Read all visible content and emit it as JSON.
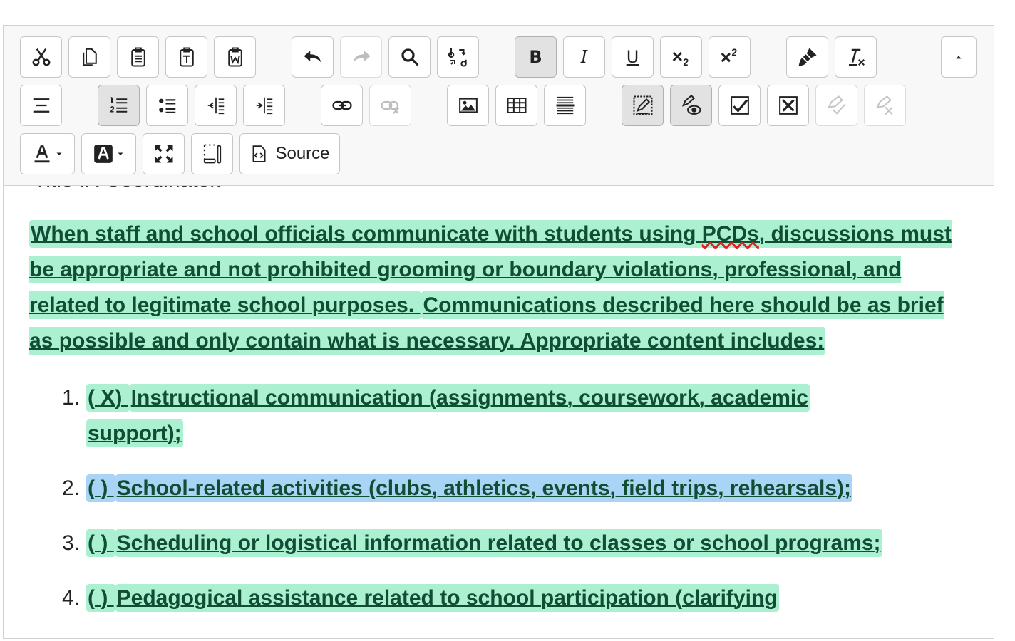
{
  "toolbar": {
    "rows": [
      [
        {
          "name": "cut-button",
          "icon": "scissors-icon"
        },
        {
          "name": "copy-button",
          "icon": "copy-icon"
        },
        {
          "name": "paste-button",
          "icon": "clipboard-icon"
        },
        {
          "name": "paste-text-button",
          "icon": "clipboard-text-icon"
        },
        {
          "name": "paste-word-button",
          "icon": "clipboard-word-icon"
        },
        {
          "name": "undo-button",
          "icon": "undo-icon"
        },
        {
          "name": "redo-button",
          "icon": "redo-icon"
        },
        {
          "name": "find-button",
          "icon": "search-icon"
        },
        {
          "name": "replace-button",
          "icon": "replace-icon"
        },
        {
          "name": "bold-button",
          "icon": "bold-icon",
          "state": "active"
        },
        {
          "name": "italic-button",
          "icon": "italic-icon"
        },
        {
          "name": "underline-button",
          "icon": "underline-icon"
        },
        {
          "name": "subscript-button",
          "icon": "subscript-icon"
        },
        {
          "name": "superscript-button",
          "icon": "superscript-icon"
        },
        {
          "name": "copy-format-button",
          "icon": "paintbrush-icon"
        },
        {
          "name": "remove-format-button",
          "icon": "remove-format-icon"
        },
        {
          "name": "collapse-toolbar-button",
          "icon": "triangle-up-icon"
        }
      ],
      [
        {
          "name": "paragraph-format-button",
          "icon": "paragraph-icon"
        },
        {
          "name": "numbered-list-button",
          "icon": "numbered-list-icon",
          "state": "active"
        },
        {
          "name": "bulleted-list-button",
          "icon": "bulleted-list-icon"
        },
        {
          "name": "decrease-indent-button",
          "icon": "outdent-icon"
        },
        {
          "name": "increase-indent-button",
          "icon": "indent-icon"
        },
        {
          "name": "link-button",
          "icon": "link-icon"
        },
        {
          "name": "unlink-button",
          "icon": "unlink-icon",
          "state": "disabled"
        },
        {
          "name": "image-button",
          "icon": "image-icon"
        },
        {
          "name": "table-button",
          "icon": "table-icon"
        },
        {
          "name": "horizontal-rule-button",
          "icon": "hr-icon"
        },
        {
          "name": "track-changes-button",
          "icon": "track-changes-icon",
          "state": "active"
        },
        {
          "name": "show-changes-button",
          "icon": "show-changes-icon",
          "state": "active"
        },
        {
          "name": "accept-change-button",
          "icon": "accept-icon"
        },
        {
          "name": "reject-change-button",
          "icon": "reject-icon"
        },
        {
          "name": "accept-all-button",
          "icon": "accept-all-icon",
          "state": "disabled"
        },
        {
          "name": "reject-all-button",
          "icon": "reject-all-icon",
          "state": "disabled"
        }
      ],
      [
        {
          "name": "text-color-button",
          "icon": "text-color-icon"
        },
        {
          "name": "background-color-button",
          "icon": "background-color-icon"
        },
        {
          "name": "maximize-button",
          "icon": "maximize-icon"
        },
        {
          "name": "show-blocks-button",
          "icon": "show-blocks-icon"
        },
        {
          "name": "source-button",
          "icon": "source-icon",
          "label": "Source"
        }
      ]
    ]
  },
  "content": {
    "cut_heading": "Title IX Coordinator.",
    "paragraph": {
      "segments": [
        "When staff and school officials communicate with students using ",
        "PCDs",
        ", discussions must be appropriate and not prohibited grooming or boundary violations, professional, and related to legitimate school purposes. ",
        " Communications described here should be as brief as possible and only contain what is necessary. Appropriate content includes:"
      ],
      "spellcheck_word": "PCDs"
    },
    "list": [
      {
        "number": "1.",
        "checkbox": "( X) ",
        "line1": "Instructional communication (assignments, coursework, academic",
        "line2": "support);",
        "selected": false
      },
      {
        "number": "2.",
        "checkbox": "( ) ",
        "line1": "School-related activities (clubs, athletics, events, field trips, rehearsals);",
        "selected": true
      },
      {
        "number": "3.",
        "checkbox": "( ) ",
        "line1": "Scheduling or logistical information related to classes or school programs;",
        "selected": false
      },
      {
        "number": "4.",
        "checkbox": "( ) ",
        "line1": "Pedagogical assistance related to school participation (clarifying",
        "selected": false
      }
    ]
  },
  "colors": {
    "insert_highlight": "#aaf0d1",
    "selection": "#aad4f5",
    "insert_text": "#114d33",
    "spellcheck": "#dd2222"
  }
}
